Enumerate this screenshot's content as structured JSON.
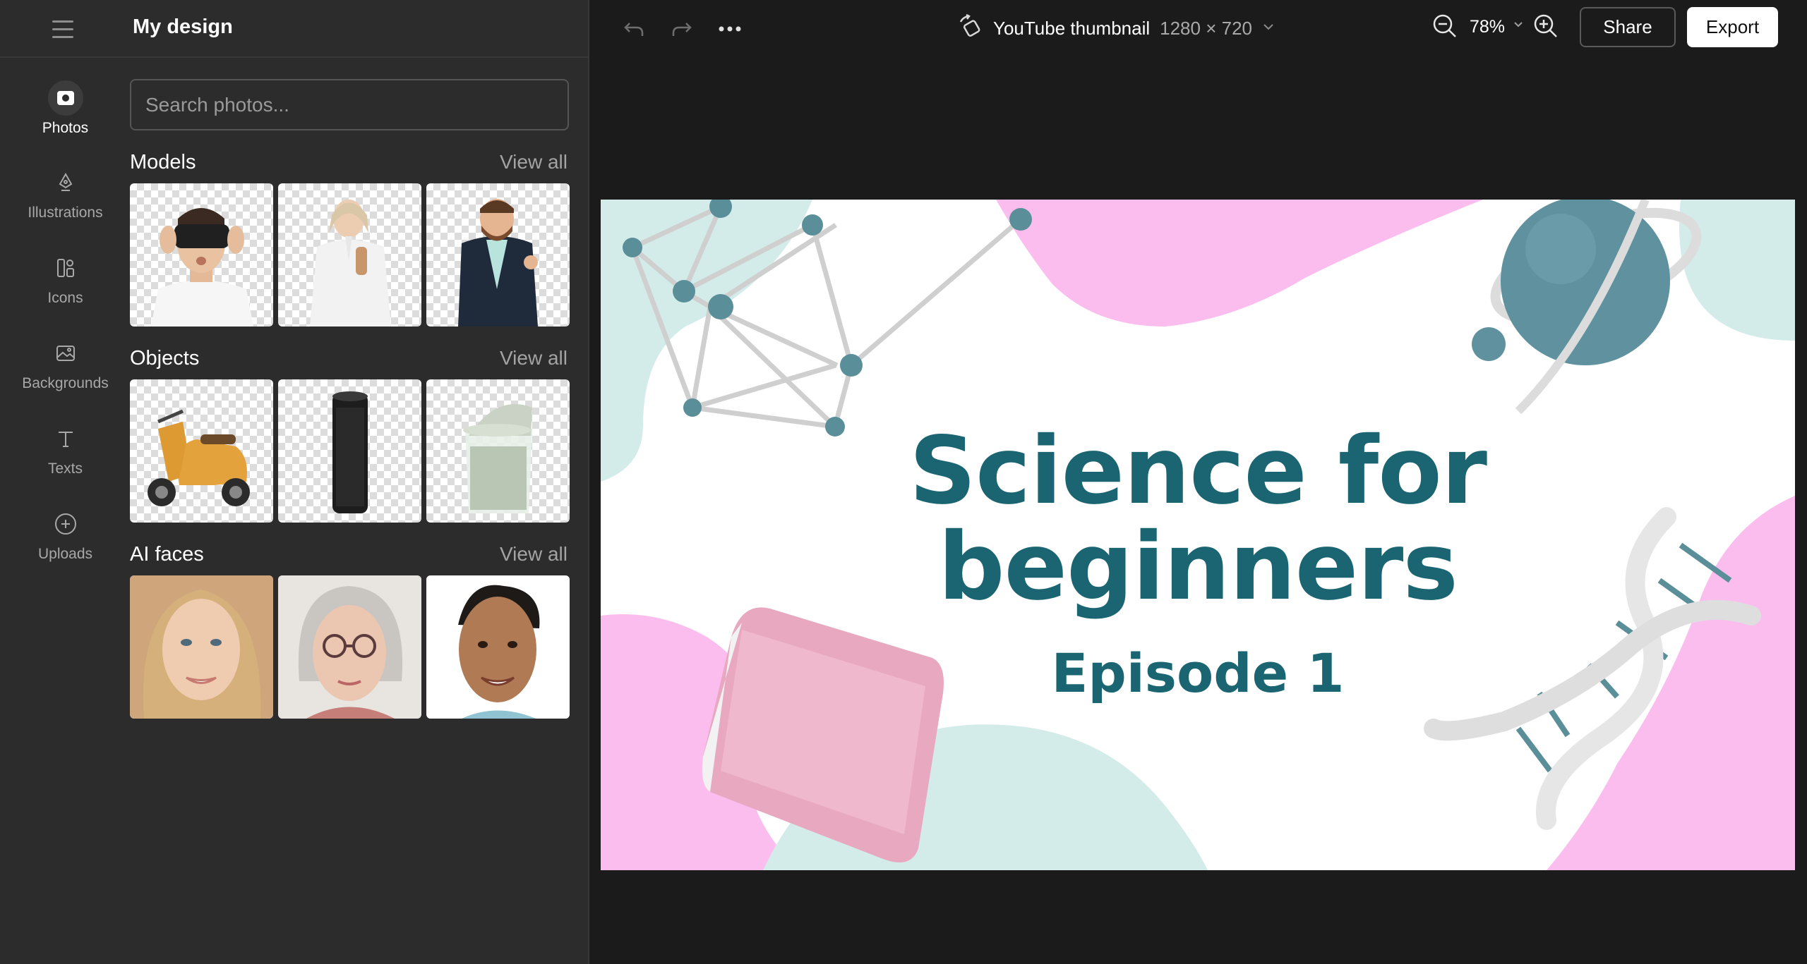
{
  "sidebar": {
    "title": "My design",
    "rail": [
      {
        "label": "Photos",
        "icon": "photo-icon",
        "active": true
      },
      {
        "label": "Illustrations",
        "icon": "pen-nib-icon"
      },
      {
        "label": "Icons",
        "icon": "shapes-icon"
      },
      {
        "label": "Backgrounds",
        "icon": "image-icon"
      },
      {
        "label": "Texts",
        "icon": "text-icon"
      },
      {
        "label": "Uploads",
        "icon": "plus-circle-icon"
      }
    ],
    "search_placeholder": "Search photos...",
    "sections": [
      {
        "title": "Models",
        "view_all": "View all",
        "items": [
          "man-vr-headset",
          "woman-bathrobe",
          "man-thumbs-up"
        ]
      },
      {
        "title": "Objects",
        "view_all": "View all",
        "items": [
          "scooter",
          "smart-speaker",
          "money-jar"
        ]
      },
      {
        "title": "AI faces",
        "view_all": "View all",
        "items": [
          "blonde-woman",
          "elderly-woman",
          "young-man"
        ]
      }
    ]
  },
  "toolbar": {
    "doc_name": "YouTube thumbnail",
    "doc_size": "1280 × 720",
    "zoom": "78%",
    "share_label": "Share",
    "export_label": "Export"
  },
  "canvas": {
    "title_line1": "Science for",
    "title_line2": "beginners",
    "subtitle": "Episode 1",
    "colors": {
      "teal_text": "#1a6571",
      "pink_blob": "#fbbdee",
      "mint_blob": "#d3ecea"
    }
  }
}
